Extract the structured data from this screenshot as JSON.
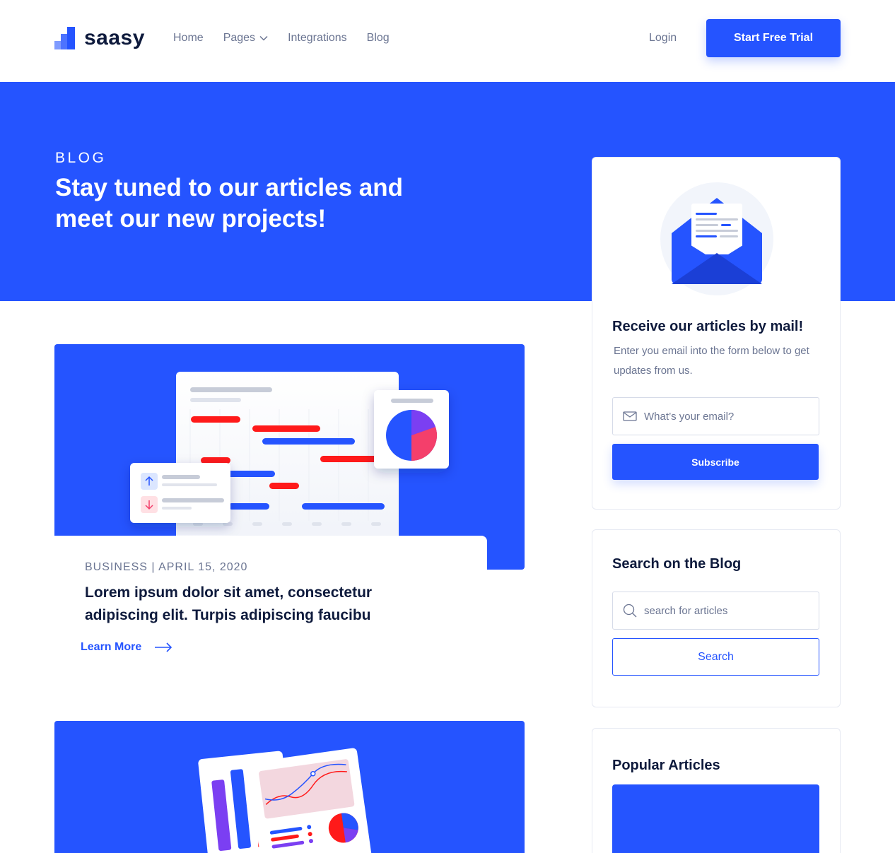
{
  "nav": {
    "brand": "saasy",
    "links": [
      {
        "label": "Home"
      },
      {
        "label": "Pages"
      },
      {
        "label": "Integrations"
      },
      {
        "label": "Blog"
      }
    ],
    "login_label": "Login",
    "cta_label": "Start Free Trial"
  },
  "hero": {
    "eyebrow": "BLOG",
    "title": "Stay tuned to our articles and meet our new projects!"
  },
  "posts": [
    {
      "meta": "BUSINESS | APRIL 15, 2020",
      "title": "Lorem ipsum dolor sit amet, consectetur adipiscing elit. Turpis adipiscing faucibu",
      "link_label": "Learn More"
    }
  ],
  "subscribe": {
    "title": "Receive our articles by mail!",
    "text": "Enter you email into the form below to get updates from us.",
    "email_placeholder": "What’s your email?",
    "button_label": "Subscribe"
  },
  "search": {
    "title": "Search on the Blog",
    "placeholder": "search for articles",
    "button_label": "Search"
  },
  "popular": {
    "title": "Popular Articles"
  },
  "colors": {
    "accent": "#2554ff",
    "dark": "#0e1a3c",
    "muted": "#6b7592",
    "chart_red": "#ff1a1a"
  }
}
